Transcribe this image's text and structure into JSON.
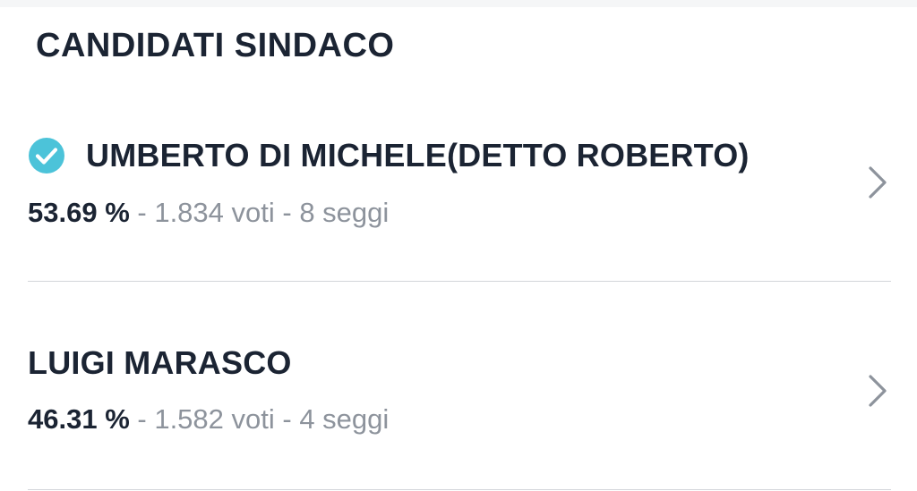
{
  "section": {
    "title": "CANDIDATI SINDACO"
  },
  "candidates": [
    {
      "name": "UMBERTO DI MICHELE(DETTO ROBERTO)",
      "percentage": "53.69 %",
      "separator_1": " - ",
      "votes": "1.834 voti",
      "separator_2": " - ",
      "seats": "8 seggi",
      "elected": true,
      "status_icon": "check-circle-icon"
    },
    {
      "name": "LUIGI MARASCO",
      "percentage": "46.31 %",
      "separator_1": " - ",
      "votes": "1.582 voti",
      "separator_2": " - ",
      "seats": "4 seggi",
      "elected": false
    }
  ],
  "icons": {
    "row_action": "chevron-right-icon"
  },
  "colors": {
    "text_primary": "#1b2433",
    "text_muted": "#8d939c",
    "elected_badge": "#4cc3d9",
    "divider": "#d3d6da",
    "chevron": "#8d939c"
  }
}
